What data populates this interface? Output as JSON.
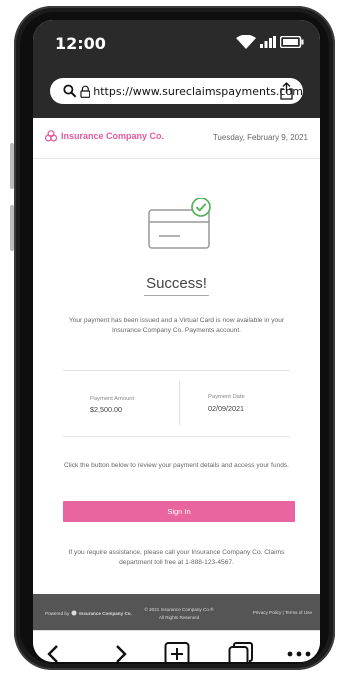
{
  "status_bar": {
    "time": "12:00"
  },
  "browser": {
    "url": "https://www.sureclaimspayments.com"
  },
  "header": {
    "brand": "Insurance Company Co.",
    "date": "Tuesday, February 9, 2021"
  },
  "main": {
    "title": "Success!",
    "message": "Your payment has been issued and a Virtual Card is now available in your Insurance Company Co. Payments account.",
    "payment_amount_label": "Payment Amount",
    "payment_amount_value": "$2,500.00",
    "payment_date_label": "Payment Date",
    "payment_date_value": "02/09/2021",
    "cta_text": "Click the button below to review your payment details and access your funds.",
    "signin_label": "Sign In",
    "assistance": "If you require assistance, please call your Insurance Company Co. Claims department toll free at 1-888-123-4567."
  },
  "footer": {
    "powered_by": "Powered by",
    "powered_brand": "Insurance Company Co.",
    "copyright_line1": "© 2021 Insurance Company Co.®",
    "copyright_line2": "All Rights Reserved",
    "links": "Privacy Policy | Terms of Use"
  },
  "colors": {
    "accent": "#e8659f",
    "check": "#4caf50",
    "footer_bg": "#555555",
    "chrome_bg": "#2a2a2a"
  },
  "icons": [
    "search-icon",
    "lock-icon",
    "share-icon",
    "wifi-icon",
    "signal-icon",
    "battery-icon",
    "back-icon",
    "forward-icon",
    "new-tab-icon",
    "tabs-icon",
    "more-icon",
    "credit-card-icon",
    "check-circle-icon",
    "brand-logo-icon"
  ]
}
